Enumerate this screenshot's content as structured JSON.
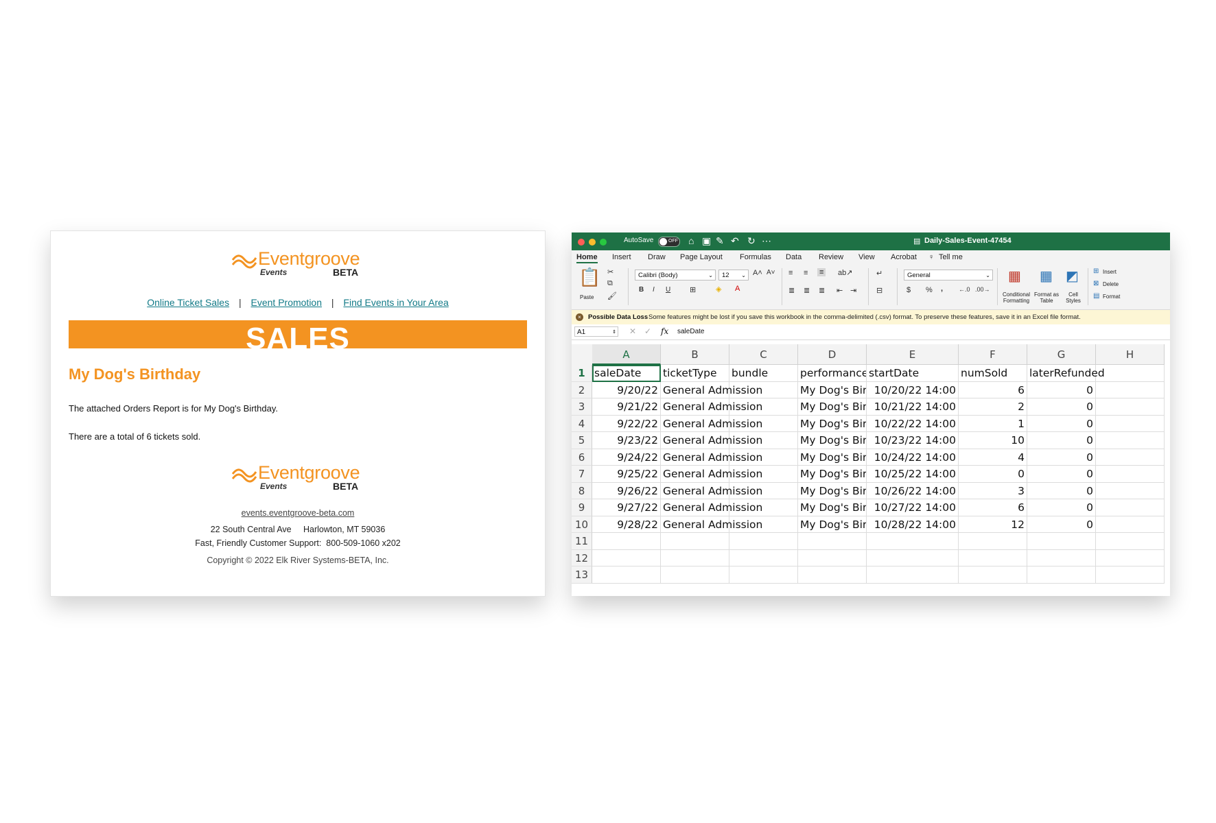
{
  "email": {
    "brand": {
      "name": "Eventgroove",
      "sub": "Events",
      "tag": "BETA"
    },
    "nav": [
      "Online Ticket Sales",
      "Event Promotion",
      "Find Events in Your Area"
    ],
    "nav_separator": "|",
    "banner": "SALES",
    "event_title": "My Dog's Birthday",
    "para1": "The attached Orders Report is for My Dog's Birthday.",
    "para2": "There are a total of 6 tickets sold.",
    "footer": {
      "website": "events.eventgroove-beta.com",
      "address": "22 South Central Ave     Harlowton, MT 59036",
      "support": "Fast, Friendly Customer Support:  800-509-1060 x202",
      "copyright": "Copyright © 2022 Elk River Systems-BETA, Inc."
    },
    "colors": {
      "accent": "#f39321",
      "link": "#127a87"
    }
  },
  "excel": {
    "autosave_label": "AutoSave",
    "autosave_state": "OFF",
    "doc_title": "Daily-Sales-Event-47454",
    "tabs": [
      "Home",
      "Insert",
      "Draw",
      "Page Layout",
      "Formulas",
      "Data",
      "Review",
      "View",
      "Acrobat",
      "Tell me"
    ],
    "ribbon": {
      "paste": "Paste",
      "font": "Calibri (Body)",
      "size": "12",
      "bold": "B",
      "italic": "I",
      "underline": "U",
      "number_format": "General",
      "currency": "$",
      "percent": "%",
      "comma": ",",
      "conditional_formatting": "Conditional Formatting",
      "format_as_table": "Format as Table",
      "cell_styles": "Cell Styles",
      "insert": "Insert",
      "delete": "Delete",
      "format": "Format"
    },
    "message": {
      "title": "Possible Data Loss",
      "text": "Some features might be lost if you save this workbook in the comma-delimited (.csv) format. To preserve these features, save it in an Excel file format."
    },
    "name_box": "A1",
    "fx": "fx",
    "formula": "saleDate",
    "columns": [
      "A",
      "B",
      "C",
      "D",
      "E",
      "F",
      "G",
      "H"
    ],
    "row_numbers": [
      "1",
      "2",
      "3",
      "4",
      "5",
      "6",
      "7",
      "8",
      "9",
      "10",
      "11",
      "12",
      "13"
    ],
    "headers": [
      "saleDate",
      "ticketType",
      "bundle",
      "performance",
      "startDate",
      "numSold",
      "laterRefunded"
    ],
    "rows": [
      [
        "9/20/22",
        "General Admission",
        "",
        "My Dog's Bir",
        "10/20/22 14:00",
        "6",
        "0"
      ],
      [
        "9/21/22",
        "General Admission",
        "",
        "My Dog's Bir",
        "10/21/22 14:00",
        "2",
        "0"
      ],
      [
        "9/22/22",
        "General Admission",
        "",
        "My Dog's Bir",
        "10/22/22 14:00",
        "1",
        "0"
      ],
      [
        "9/23/22",
        "General Admission",
        "",
        "My Dog's Bir",
        "10/23/22 14:00",
        "10",
        "0"
      ],
      [
        "9/24/22",
        "General Admission",
        "",
        "My Dog's Bir",
        "10/24/22 14:00",
        "4",
        "0"
      ],
      [
        "9/25/22",
        "General Admission",
        "",
        "My Dog's Bir",
        "10/25/22 14:00",
        "0",
        "0"
      ],
      [
        "9/26/22",
        "General Admission",
        "",
        "My Dog's Bir",
        "10/26/22 14:00",
        "3",
        "0"
      ],
      [
        "9/27/22",
        "General Admission",
        "",
        "My Dog's Bir",
        "10/27/22 14:00",
        "6",
        "0"
      ],
      [
        "9/28/22",
        "General Admission",
        "",
        "My Dog's Bir",
        "10/28/22 14:00",
        "12",
        "0"
      ]
    ],
    "colors": {
      "titlebar": "#1e7145",
      "accent": "#1e7145"
    }
  }
}
